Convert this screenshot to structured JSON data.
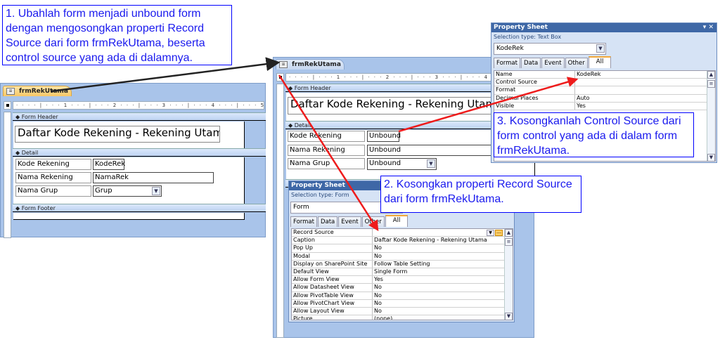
{
  "callouts": {
    "step1": "1. Ubahlah form menjadi unbound form dengan mengosongkan properti Record Source dari form frmRekUtama, beserta control source yang ada di dalamnya.",
    "step2": "2. Kosongkan properti Record Source dari form frmRekUtama.",
    "step3": "3. Kosongkanlah Control Source dari form control yang ada di dalam form frmRekUtama."
  },
  "ruler_text": "· · · · | · · · 1 · · · | · · · 2 · · · | · · · 3 · · · | · · · 4 · · · | · · · 5",
  "before_form": {
    "tab": "frmRekUtama",
    "sections": {
      "header": "Form Header",
      "detail": "Detail",
      "footer": "Form Footer"
    },
    "title": "Daftar Kode Rekening - Rekening Utama",
    "rows": [
      {
        "label": "Kode Rekening",
        "value": "KodeRek"
      },
      {
        "label": "Nama Rekening",
        "value": "NamaRek"
      },
      {
        "label": "Nama Grup",
        "value": "Grup"
      }
    ]
  },
  "after_form": {
    "tab": "frmRekUtama",
    "sections": {
      "header": "Form Header",
      "detail": "Detail"
    },
    "title": "Daftar Kode Rekening - Rekening Utama",
    "rows": [
      {
        "label": "Kode Rekening",
        "value": "Unbound"
      },
      {
        "label": "Nama Rekening",
        "value": "Unbound"
      },
      {
        "label": "Nama Grup",
        "value": "Unbound"
      }
    ]
  },
  "form_props": {
    "title": "Property Sheet",
    "selection_type": "Selection type:  Form",
    "object": "Form",
    "tabs": [
      "Format",
      "Data",
      "Event",
      "Other",
      "All"
    ],
    "active_tab": "All",
    "rows": [
      {
        "name": "Record Source",
        "value": ""
      },
      {
        "name": "Caption",
        "value": "Daftar Kode Rekening - Rekening Utama"
      },
      {
        "name": "Pop Up",
        "value": "No"
      },
      {
        "name": "Modal",
        "value": "No"
      },
      {
        "name": "Display on SharePoint Site",
        "value": "Follow Table Setting"
      },
      {
        "name": "Default View",
        "value": "Single Form"
      },
      {
        "name": "Allow Form View",
        "value": "Yes"
      },
      {
        "name": "Allow Datasheet View",
        "value": "No"
      },
      {
        "name": "Allow PivotTable View",
        "value": "No"
      },
      {
        "name": "Allow PivotChart View",
        "value": "No"
      },
      {
        "name": "Allow Layout View",
        "value": "No"
      },
      {
        "name": "Picture",
        "value": "(none)"
      }
    ]
  },
  "textbox_props": {
    "title": "Property Sheet",
    "selection_type": "Selection type:  Text Box",
    "object": "KodeRek",
    "tabs": [
      "Format",
      "Data",
      "Event",
      "Other",
      "All"
    ],
    "active_tab": "All",
    "rows": [
      {
        "name": "Name",
        "value": "KodeRek"
      },
      {
        "name": "Control Source",
        "value": ""
      },
      {
        "name": "Format",
        "value": ""
      },
      {
        "name": "Decimal Places",
        "value": "Auto"
      },
      {
        "name": "Visible",
        "value": "Yes"
      }
    ]
  },
  "colors": {
    "callout_text": "#1a1aee",
    "arrow_red": "#ee1c1c",
    "designer_bg": "#a9c4ea"
  }
}
